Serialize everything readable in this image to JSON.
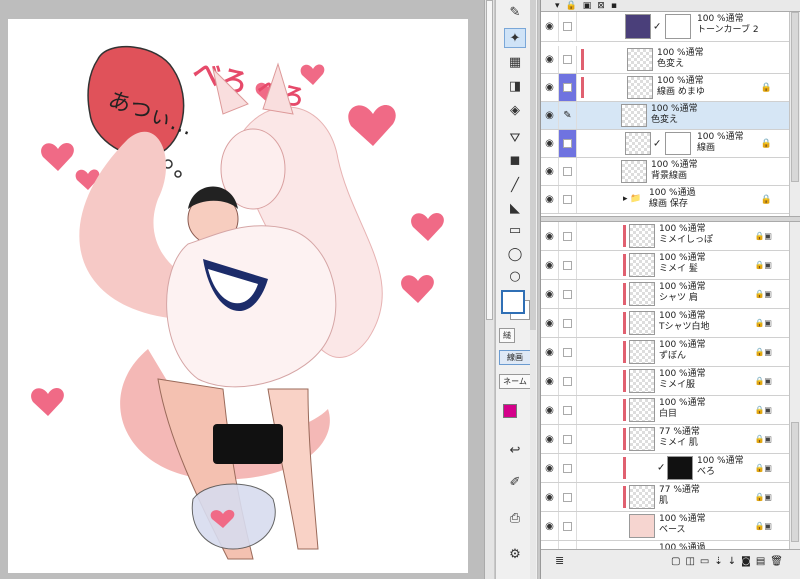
{
  "layers_top": [
    {
      "mode": "100 %通常",
      "name": "トーンカーブ 2",
      "thumb": "tone",
      "mark": false,
      "lock": false,
      "selected": false,
      "blue": false,
      "pen": false,
      "tick": true
    },
    {
      "mode": "100 %通常",
      "name": "色変え",
      "thumb": "check",
      "mark": true,
      "lock": false,
      "selected": false,
      "blue": false,
      "pen": false,
      "tick": false
    },
    {
      "mode": "100 %通常",
      "name": "線画 めまゆ",
      "thumb": "check",
      "mark": true,
      "lock": true,
      "selected": false,
      "blue": true,
      "pen": false,
      "tick": false
    },
    {
      "mode": "100 %通常",
      "name": "色変え",
      "thumb": "check",
      "mark": false,
      "lock": false,
      "selected": true,
      "blue": false,
      "pen": true,
      "tick": false
    },
    {
      "mode": "100 %通常",
      "name": "線画",
      "thumb": "check",
      "mark": false,
      "lock": true,
      "selected": false,
      "blue": true,
      "pen": false,
      "tick": true
    },
    {
      "mode": "100 %通常",
      "name": "背景線画",
      "thumb": "check",
      "mark": false,
      "lock": false,
      "selected": false,
      "blue": false,
      "pen": false,
      "tick": false
    },
    {
      "mode": "100 %通過",
      "name": "線画 保存",
      "thumb": "folder",
      "mark": false,
      "lock": true,
      "selected": false,
      "blue": false,
      "pen": false,
      "tick": false
    }
  ],
  "layers_bottom": [
    {
      "mode": "100 %通常",
      "name": "ミメイしっぽ",
      "thumb": "check",
      "mark": true
    },
    {
      "mode": "100 %通常",
      "name": "ミメイ 髪",
      "thumb": "check",
      "mark": true
    },
    {
      "mode": "100 %通常",
      "name": "シャツ 肩",
      "thumb": "check",
      "mark": true
    },
    {
      "mode": "100 %通常",
      "name": "Tシャツ白地",
      "thumb": "check",
      "mark": true
    },
    {
      "mode": "100 %通常",
      "name": "ずぼん",
      "thumb": "check",
      "mark": true
    },
    {
      "mode": "100 %通常",
      "name": "ミメイ服",
      "thumb": "check",
      "mark": true
    },
    {
      "mode": "100 %通常",
      "name": "白目",
      "thumb": "check",
      "mark": true
    },
    {
      "mode": "77 %通常",
      "name": "ミメイ 肌",
      "thumb": "check",
      "mark": true
    },
    {
      "mode": "100 %通常",
      "name": "べろ",
      "thumb": "dark",
      "mark": true,
      "tick": true
    },
    {
      "mode": "77 %通常",
      "name": "肌",
      "thumb": "check",
      "mark": true
    },
    {
      "mode": "100 %通常",
      "name": "ベース",
      "thumb": "blush",
      "mark": false
    },
    {
      "mode": "100 %通過",
      "name": "",
      "thumb": "none",
      "mark": false
    }
  ],
  "tool_panel": {
    "tab_line": "線画",
    "tab_name": "ネーム",
    "tab_small": "縋"
  },
  "canvas_text": {
    "bubble": "あつぃ…",
    "bero1": "べろ",
    "bero2": "べろ"
  },
  "colors": {
    "accent_blue": "#6f73e0",
    "selected_row": "#d6e6f5",
    "layer_mark": "#e06070",
    "main_color": "#d4008a",
    "bubble_fill": "#e0525a",
    "heart_fill": "#f06a86"
  }
}
